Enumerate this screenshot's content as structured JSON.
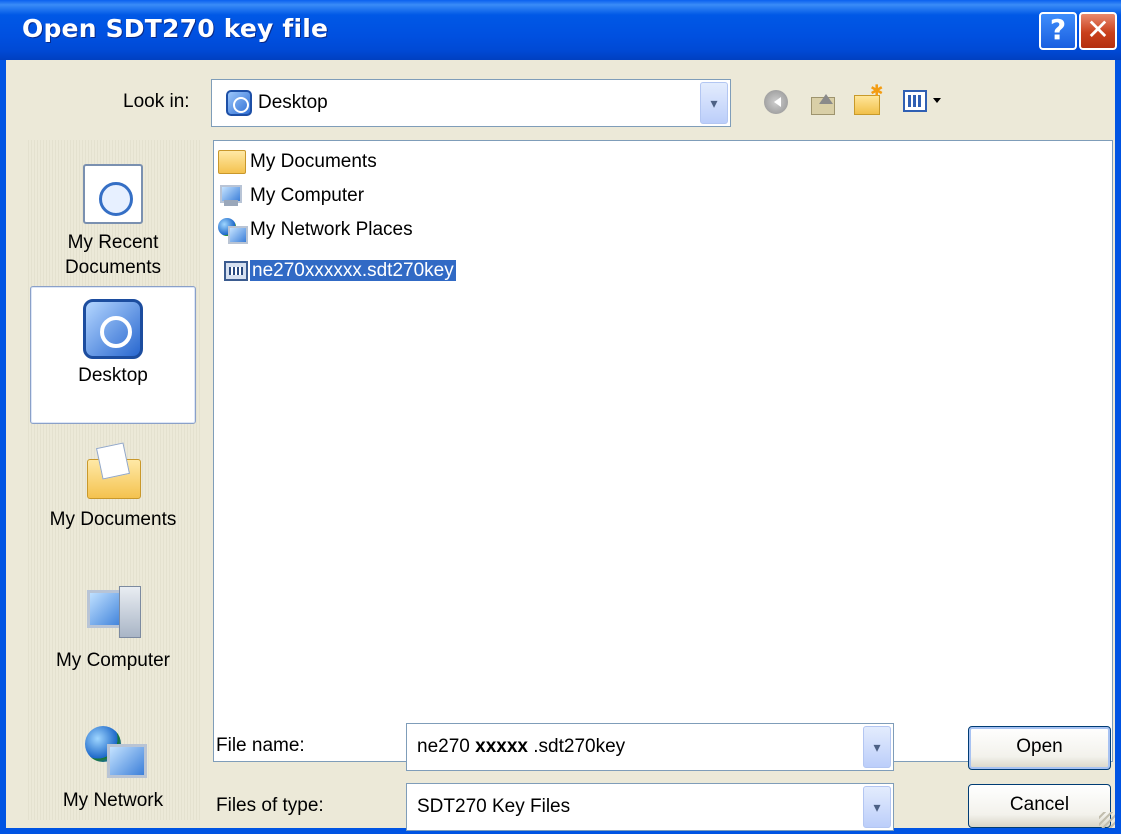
{
  "window": {
    "title": "Open SDT270 key file",
    "help_glyph": "?",
    "close_glyph": "✕"
  },
  "lookin": {
    "label": "Look in:",
    "value": "Desktop",
    "icon": "desktop-icon",
    "arrow": "▾"
  },
  "toolbar": {
    "icons": [
      "back-icon",
      "up-folder-icon",
      "new-folder-icon",
      "views-menu-icon"
    ]
  },
  "places": [
    {
      "label_line1": "My Recent",
      "label_line2": "Documents",
      "icon": "recent-documents-icon"
    },
    {
      "label_line1": "Desktop",
      "label_line2": "",
      "icon": "desktop-icon",
      "selected": true
    },
    {
      "label_line1": "My Documents",
      "label_line2": "",
      "icon": "my-documents-icon"
    },
    {
      "label_line1": "My Computer",
      "label_line2": "",
      "icon": "my-computer-icon"
    },
    {
      "label_line1": "My Network",
      "label_line2": "",
      "icon": "my-network-icon"
    }
  ],
  "files": [
    {
      "name": "My Documents",
      "icon": "folder-icon"
    },
    {
      "name": "My Computer",
      "icon": "computer-icon"
    },
    {
      "name": "My Network Places",
      "icon": "network-icon"
    },
    {
      "name": "ne270xxxxxx.sdt270key",
      "icon": "key-file-icon",
      "selected": true
    }
  ],
  "filename": {
    "label": "File name:",
    "value_prefix": "ne270 ",
    "value_bold": "xxxxx",
    "value_suffix": " .sdt270key"
  },
  "filetype": {
    "label": "Files of type:",
    "value": "SDT270 Key Files"
  },
  "buttons": {
    "open": "Open",
    "cancel": "Cancel"
  }
}
